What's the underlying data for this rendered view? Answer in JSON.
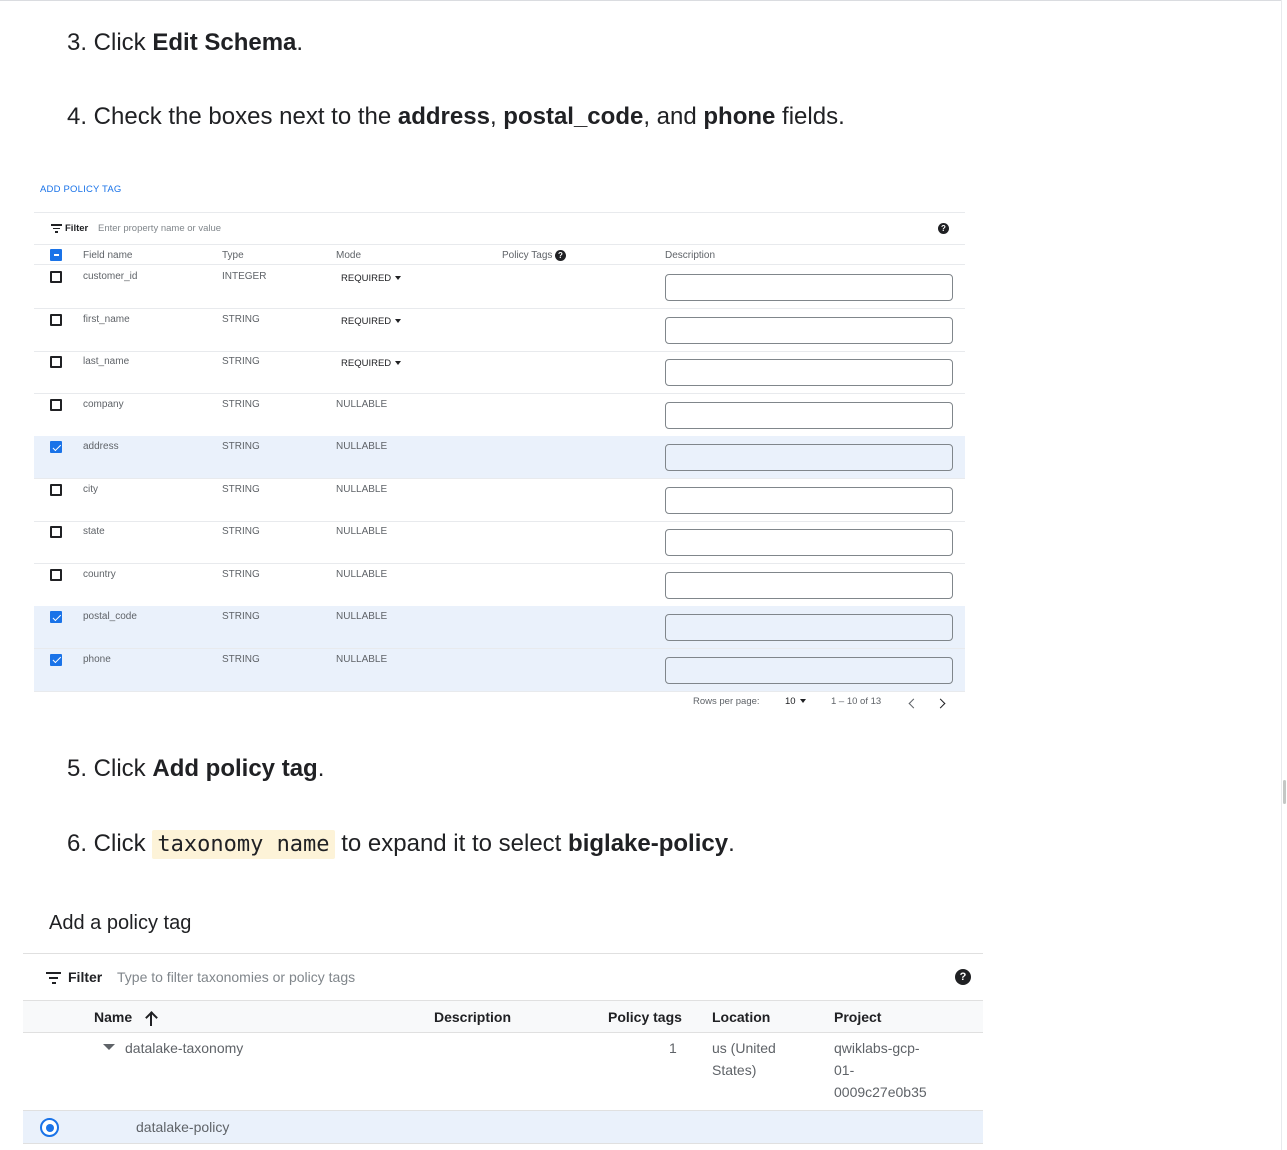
{
  "steps": [
    {
      "num": "3. Click ",
      "bold": "Edit Schema",
      "after": "."
    },
    {
      "num": "4. Check the boxes next to the ",
      "b1": "address",
      "s1": ", ",
      "b2": "postal_code",
      "s2": ", and ",
      "b3": "phone",
      "after": " fields."
    },
    {
      "num": "5. Click ",
      "bold": "Add policy tag",
      "after": "."
    },
    {
      "num": "6. Click ",
      "code": "taxonomy name",
      "mid": " to expand it to select ",
      "bold": "biglake-policy",
      "after": "."
    }
  ],
  "schema": {
    "add_policy_link": "ADD POLICY TAG",
    "filter_label": "Filter",
    "filter_placeholder": "Enter property name or value",
    "help_icon": "help-circle-icon",
    "columns": [
      "Field name",
      "Type",
      "Mode",
      "Policy Tags",
      "Description"
    ],
    "rows": [
      {
        "name": "customer_id",
        "type": "INTEGER",
        "mode": "REQUIRED",
        "dropdown": true,
        "checked": false
      },
      {
        "name": "first_name",
        "type": "STRING",
        "mode": "REQUIRED",
        "dropdown": true,
        "checked": false
      },
      {
        "name": "last_name",
        "type": "STRING",
        "mode": "REQUIRED",
        "dropdown": true,
        "checked": false
      },
      {
        "name": "company",
        "type": "STRING",
        "mode": "NULLABLE",
        "dropdown": false,
        "checked": false
      },
      {
        "name": "address",
        "type": "STRING",
        "mode": "NULLABLE",
        "dropdown": false,
        "checked": true
      },
      {
        "name": "city",
        "type": "STRING",
        "mode": "NULLABLE",
        "dropdown": false,
        "checked": false
      },
      {
        "name": "state",
        "type": "STRING",
        "mode": "NULLABLE",
        "dropdown": false,
        "checked": false
      },
      {
        "name": "country",
        "type": "STRING",
        "mode": "NULLABLE",
        "dropdown": false,
        "checked": false
      },
      {
        "name": "postal_code",
        "type": "STRING",
        "mode": "NULLABLE",
        "dropdown": false,
        "checked": true
      },
      {
        "name": "phone",
        "type": "STRING",
        "mode": "NULLABLE",
        "dropdown": false,
        "checked": true
      }
    ],
    "pagination": {
      "rows_per_page_label": "Rows per page:",
      "rows_per_page": "10",
      "range": "1 – 10 of 13"
    }
  },
  "policy_panel": {
    "title": "Add a policy tag",
    "filter_label": "Filter",
    "filter_placeholder": "Type to filter taxonomies or policy tags",
    "columns": {
      "name": "Name",
      "description": "Description",
      "policy_tags": "Policy tags",
      "location": "Location",
      "project": "Project"
    },
    "taxonomy": {
      "name": "datalake-taxonomy",
      "policy_tags": "1",
      "location_1": "us (United",
      "location_2": "States)",
      "project_1": "qwiklabs-gcp-",
      "project_2": "01-",
      "project_3": "0009c27e0b35"
    },
    "policy_tag": {
      "name": "datalake-policy",
      "selected": true
    }
  },
  "colors": {
    "accent": "#1a73e8",
    "selected_row": "#eaf1fb",
    "code_bg": "#fdf3d8"
  }
}
